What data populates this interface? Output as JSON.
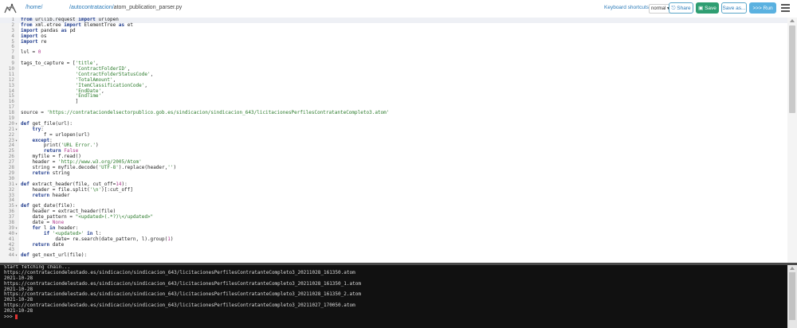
{
  "header": {
    "home_link": "/home/",
    "path_folder": "autocontratacion",
    "path_sep": "/",
    "path_file": "atom_publication_parser.py",
    "keyboard_shortcuts_label": "Keyboard shortcuts:",
    "keyboard_mode": "normal",
    "share_label": "Share",
    "save_label": "Save",
    "save_as_label": "Save as...",
    "run_label": ">>> Run"
  },
  "colors": {
    "accent_link": "#2b7bb9",
    "save_green": "#2f9e72",
    "run_blue": "#5ab1e0",
    "console_bg": "#111111",
    "cursor_red": "#dd3333"
  },
  "code_lines": [
    {
      "n": "1",
      "fold": "",
      "html": "<span class=\"kw\">from</span> urllib.request <span class=\"kw\">import</span> urlopen"
    },
    {
      "n": "2",
      "fold": "",
      "html": "<span class=\"kw\">from</span> xml.etree <span class=\"kw\">import</span> ElementTree <span class=\"kw\">as</span> et"
    },
    {
      "n": "3",
      "fold": "",
      "html": "<span class=\"kw\">import</span> pandas <span class=\"kw\">as</span> pd"
    },
    {
      "n": "4",
      "fold": "",
      "html": "<span class=\"kw\">import</span> os"
    },
    {
      "n": "5",
      "fold": "",
      "html": "<span class=\"kw\">import</span> re"
    },
    {
      "n": "6",
      "fold": "",
      "html": ""
    },
    {
      "n": "7",
      "fold": "",
      "html": "lvl = <span class=\"cn\">0</span>"
    },
    {
      "n": "8",
      "fold": "",
      "html": ""
    },
    {
      "n": "9",
      "fold": "",
      "html": "tags_to_capture = [<span class=\"st\">'title'</span>,"
    },
    {
      "n": "10",
      "fold": "",
      "html": "                   <span class=\"st\">'ContractFolderID'</span>,"
    },
    {
      "n": "11",
      "fold": "",
      "html": "                   <span class=\"st\">'ContractFolderStatusCode'</span>,"
    },
    {
      "n": "12",
      "fold": "",
      "html": "                   <span class=\"st\">'TotalAmount'</span>,"
    },
    {
      "n": "13",
      "fold": "",
      "html": "                   <span class=\"st\">'ItemClassificationCode'</span>,"
    },
    {
      "n": "14",
      "fold": "",
      "html": "                   <span class=\"st\">'EndDate'</span>,"
    },
    {
      "n": "15",
      "fold": "",
      "html": "                   <span class=\"st\">'EndTime'</span>"
    },
    {
      "n": "16",
      "fold": "",
      "html": "                   ]"
    },
    {
      "n": "17",
      "fold": "",
      "html": ""
    },
    {
      "n": "18",
      "fold": "",
      "html": "source = <span class=\"st\">'https://contrataciondelsectorpublico.gob.es/sindicacion/sindicacion_643/licitacionesPerfilesContratanteCompleto3.atom'</span>"
    },
    {
      "n": "19",
      "fold": "",
      "html": ""
    },
    {
      "n": "20",
      "fold": "▾",
      "html": "<span class=\"kw\">def</span> get_file(url):"
    },
    {
      "n": "21",
      "fold": "▾",
      "html": "    <span class=\"kw\">try</span>:"
    },
    {
      "n": "22",
      "fold": "",
      "html": "        f = urlopen(url)"
    },
    {
      "n": "23",
      "fold": "▾",
      "html": "    <span class=\"kw\">except</span>:"
    },
    {
      "n": "24",
      "fold": "",
      "html": "        print(<span class=\"st\">'URL Error.'</span>)"
    },
    {
      "n": "25",
      "fold": "",
      "html": "        <span class=\"kw\">return</span> <span class=\"cn\">False</span>"
    },
    {
      "n": "26",
      "fold": "",
      "html": "    myfile = f.read()"
    },
    {
      "n": "27",
      "fold": "",
      "html": "    header = <span class=\"st\">'http://www.w3.org/2005/Atom'</span>"
    },
    {
      "n": "28",
      "fold": "",
      "html": "    string = myfile.decode(<span class=\"st\">'UTF-8'</span>).replace(header,<span class=\"st\">''</span>)"
    },
    {
      "n": "29",
      "fold": "",
      "html": "    <span class=\"kw\">return</span> string"
    },
    {
      "n": "30",
      "fold": "",
      "html": ""
    },
    {
      "n": "31",
      "fold": "▾",
      "html": "<span class=\"kw\">def</span> extract_header(file, cut_off=<span class=\"cn\">14</span>):"
    },
    {
      "n": "32",
      "fold": "",
      "html": "    header = file.split(<span class=\"st\">'\\n'</span>)[:cut_off]"
    },
    {
      "n": "33",
      "fold": "",
      "html": "    <span class=\"kw\">return</span> header"
    },
    {
      "n": "34",
      "fold": "",
      "html": ""
    },
    {
      "n": "35",
      "fold": "▾",
      "html": "<span class=\"kw\">def</span> get_date(file):"
    },
    {
      "n": "36",
      "fold": "",
      "html": "    header = extract_header(file)"
    },
    {
      "n": "37",
      "fold": "",
      "html": "    date_pattern = <span class=\"st\">\"&lt;updated&gt;(.*?)\\&lt;/updated&gt;\"</span>"
    },
    {
      "n": "38",
      "fold": "",
      "html": "    date = <span class=\"cn\">None</span>"
    },
    {
      "n": "39",
      "fold": "▾",
      "html": "    <span class=\"kw\">for</span> l <span class=\"kw\">in</span> header:"
    },
    {
      "n": "40",
      "fold": "▾",
      "html": "        <span class=\"kw\">if</span> <span class=\"st\">'&lt;updated&gt;'</span> <span class=\"kw\">in</span> l:"
    },
    {
      "n": "41",
      "fold": "",
      "html": "            date= re.search(date_pattern, l).group(<span class=\"cn\">1</span>)"
    },
    {
      "n": "42",
      "fold": "",
      "html": "    <span class=\"kw\">return</span> date"
    },
    {
      "n": "43",
      "fold": "",
      "html": ""
    },
    {
      "n": "44",
      "fold": "▾",
      "html": "<span class=\"kw\">def</span> get_next_url(file):"
    }
  ],
  "console_lines": [
    "Start fetching chain...",
    "https://contrataciondelestado.es/sindicacion/sindicacion_643/licitacionesPerfilesContratanteCompleto3_20211028_161350.atom",
    "2021-10-28",
    "https://contrataciondelestado.es/sindicacion/sindicacion_643/licitacionesPerfilesContratanteCompleto3_20211028_161350_1.atom",
    "2021-10-28",
    "https://contrataciondelestado.es/sindicacion/sindicacion_643/licitacionesPerfilesContratanteCompleto3_20211028_161350_2.atom",
    "2021-10-28",
    "https://contrataciondelestado.es/sindicacion/sindicacion_643/licitacionesPerfilesContratanteCompleto3_20211027_170050.atom",
    "2021-10-28"
  ],
  "console_prompt": ">>> "
}
